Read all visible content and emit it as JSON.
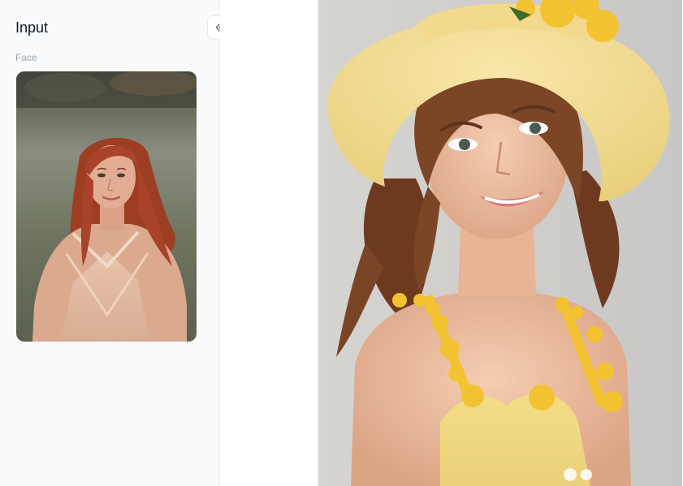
{
  "sidebar": {
    "title": "Input",
    "collapse_icon": "double-chevron-left-icon",
    "sections": [
      {
        "label": "Face",
        "image": "input-face-portrait"
      }
    ]
  },
  "main": {
    "result_image": "generated-portrait"
  },
  "colors": {
    "sidebar_bg": "#f8fafc",
    "border": "#e5e7eb",
    "hat": "#f3dc8c",
    "flowers": "#f2c230"
  }
}
